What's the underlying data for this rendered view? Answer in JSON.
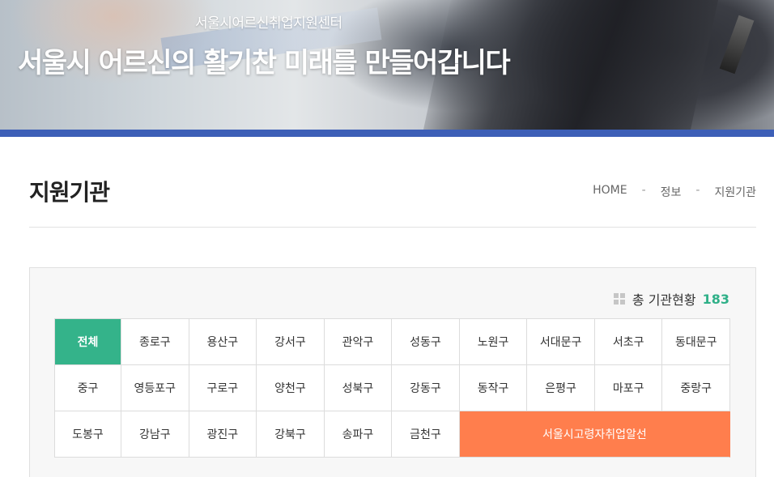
{
  "hero": {
    "subtitle": "서울시어르신취업지원센터",
    "title": "서울시 어르신의 활기찬 미래를 만들어갑니다"
  },
  "page": {
    "title": "지원기관"
  },
  "breadcrumb": [
    "HOME",
    "정보",
    "지원기관"
  ],
  "breadcrumb_separator": "-",
  "summary": {
    "label": "총 기관현황",
    "count": "183"
  },
  "districts": [
    "전체",
    "종로구",
    "용산구",
    "강서구",
    "관악구",
    "성동구",
    "노원구",
    "서대문구",
    "서초구",
    "동대문구",
    "중구",
    "영등포구",
    "구로구",
    "양천구",
    "성북구",
    "강동구",
    "동작구",
    "은평구",
    "마포구",
    "중랑구",
    "도봉구",
    "강남구",
    "광진구",
    "강북구",
    "송파구",
    "금천구"
  ],
  "special_agency": "서울시고령자취업알선",
  "colors": {
    "accent_bar": "#3d5fb7",
    "active_tab": "#34b38a",
    "special_tab": "#ff7e4d",
    "count_text": "#2fb088"
  }
}
